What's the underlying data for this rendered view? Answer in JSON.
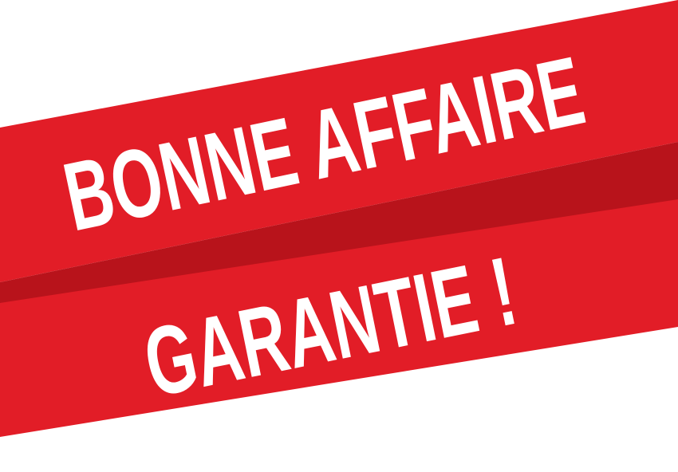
{
  "banner": {
    "line1": "BONNE AFFAIRE",
    "line2": "GARANTIE !"
  },
  "colors": {
    "ribbon": "#e21d27",
    "ribbon_shadow": "#b8131b",
    "text": "#ffffff",
    "background": "#ffffff"
  }
}
